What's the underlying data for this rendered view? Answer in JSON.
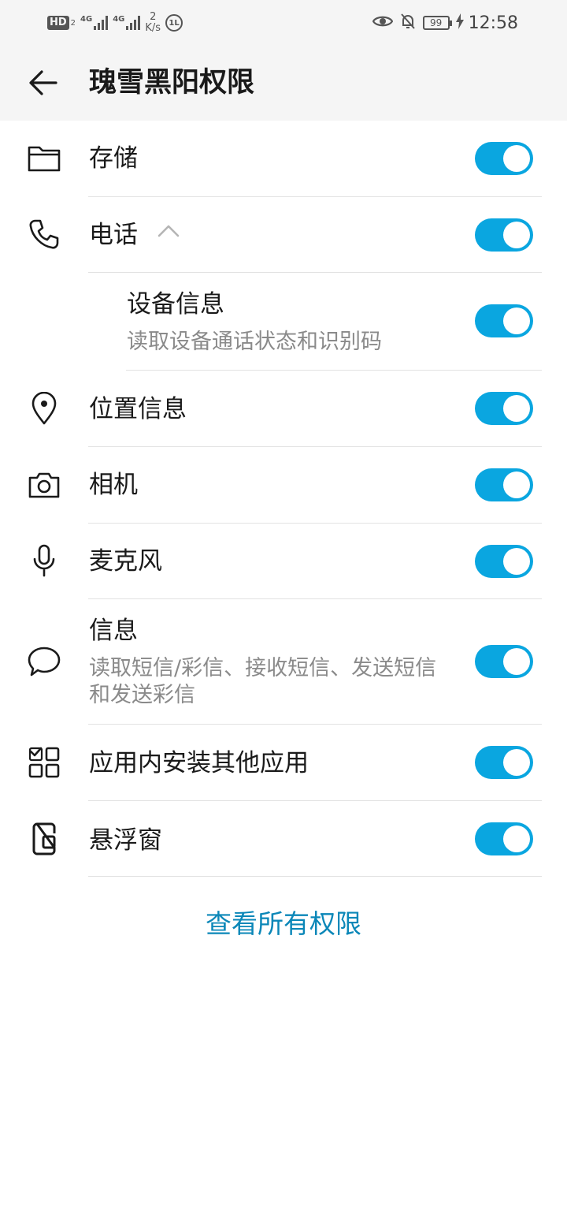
{
  "status_bar": {
    "hd_label": "HD",
    "hd_sub": "2",
    "net1_label": "4G",
    "net2_label": "4G",
    "speed_value": "2",
    "speed_unit": "K/s",
    "circle_icon_text": "1L",
    "battery_level": "99",
    "time": "12:58"
  },
  "header": {
    "title": "瑰雪黑阳权限"
  },
  "permissions": [
    {
      "title": "存储",
      "enabled": true,
      "icon": "folder-icon"
    },
    {
      "title": "电话",
      "enabled": true,
      "icon": "phone-icon",
      "expanded": true
    },
    {
      "title": "设备信息",
      "subtitle": "读取设备通话状态和识别码",
      "enabled": true
    },
    {
      "title": "位置信息",
      "enabled": true,
      "icon": "location-pin-icon"
    },
    {
      "title": "相机",
      "enabled": true,
      "icon": "camera-icon"
    },
    {
      "title": "麦克风",
      "enabled": true,
      "icon": "microphone-icon"
    },
    {
      "title": "信息",
      "subtitle": "读取短信/彩信、接收短信、发送短信和发送彩信",
      "enabled": true,
      "icon": "message-bubble-icon"
    },
    {
      "title": "应用内安装其他应用",
      "enabled": true,
      "icon": "app-install-icon"
    },
    {
      "title": "悬浮窗",
      "enabled": true,
      "icon": "floating-window-icon"
    }
  ],
  "footer": {
    "view_all_label": "查看所有权限"
  },
  "colors": {
    "toggle_on": "#0aa6e0",
    "link": "#0b87b8",
    "header_bg": "#f5f5f5"
  }
}
